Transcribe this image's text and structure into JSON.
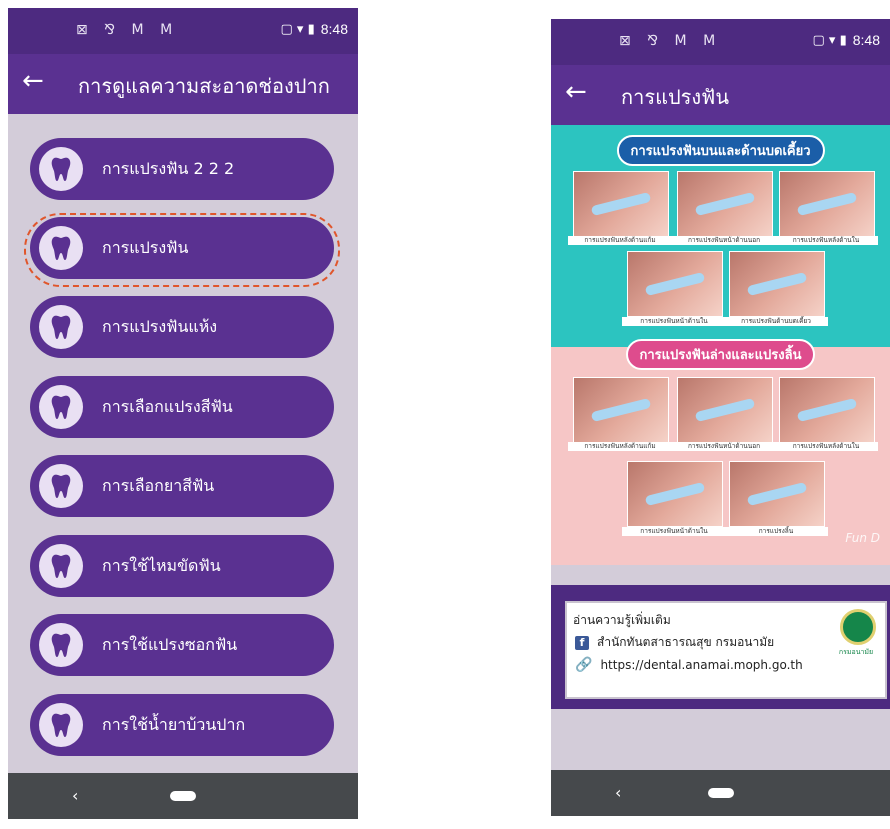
{
  "left_screen": {
    "status": {
      "time": "8:48",
      "left_icons": "⊠ ⅋ M M",
      "right_icons": "▢ ▾ ▮"
    },
    "appbar": {
      "back": "←",
      "title": "การดูแลความสะอาดช่องปาก"
    },
    "menu_items": [
      {
        "label": "การแปรงฟัน 2 2 2"
      },
      {
        "label": "การแปรงฟัน"
      },
      {
        "label": "การแปรงฟันแห้ง"
      },
      {
        "label": "การเลือกแปรงสีฟัน"
      },
      {
        "label": "การเลือกยาสีฟัน"
      },
      {
        "label": "การใช้ไหมขัดฟัน"
      },
      {
        "label": "การใช้แปรงซอกฟัน"
      },
      {
        "label": "การใช้น้ำยาบ้วนปาก"
      }
    ],
    "highlighted_index": 1,
    "nav": {
      "back": "‹"
    }
  },
  "right_screen": {
    "status": {
      "time": "8:48",
      "left_icons": "⊠ ⅋ M M",
      "right_icons": "▢ ▾ ▮"
    },
    "appbar": {
      "back": "←",
      "title": "การแปรงฟัน"
    },
    "infographic": {
      "top_heading": "การแปรงฟันบนและด้านบดเคี้ยว",
      "top_captions": [
        "การแปรงฟันหลังด้านแก้ม",
        "การแปรงฟันหน้าด้านนอก",
        "การแปรงฟันหลังด้านใน",
        "การแปรงฟันหน้าด้านใน",
        "การแปรงฟันด้านบดเคี้ยว"
      ],
      "bottom_heading": "การแปรงฟันล่างและแปรงลิ้น",
      "bottom_captions": [
        "การแปรงฟันหลังด้านแก้ม",
        "การแปรงฟันหน้าด้านนอก",
        "การแปรงฟันหลังด้านใน",
        "การแปรงฟันหน้าด้านใน",
        "การแปรงลิ้น"
      ],
      "watermark": "Fun D"
    },
    "info": {
      "read_more": "อ่านความรู้เพิ่มเติม",
      "facebook": "สำนักทันตสาธารณสุข กรมอนามัย",
      "link": "https://dental.anamai.moph.go.th",
      "logo_text": "กรมอนามัย"
    },
    "nav": {
      "back": "‹"
    }
  },
  "colors": {
    "purple_dark": "#4d2a80",
    "purple": "#5a3191",
    "bg": "#d3ccd9",
    "highlight": "#e0562c"
  }
}
